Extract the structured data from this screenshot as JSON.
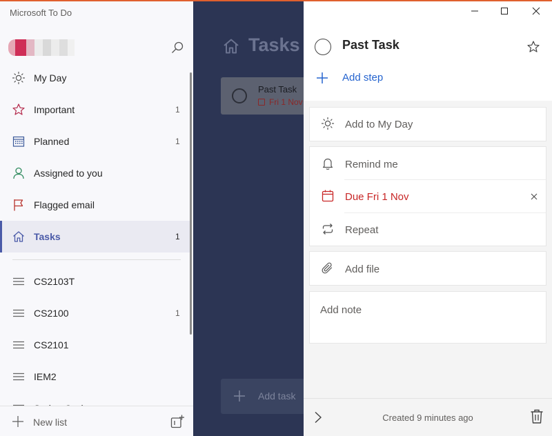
{
  "app": {
    "title": "Microsoft To Do"
  },
  "colors": {
    "accent": "#4a5aa8",
    "link": "#2564cf",
    "due_red": "#c82626",
    "overlay": "#2c3554",
    "top_border": "#e0602e"
  },
  "sidebar": {
    "profile_avatar": "blurred-avatar",
    "nav": [
      {
        "icon": "sun-icon",
        "label": "My Day",
        "count": ""
      },
      {
        "icon": "star-icon",
        "label": "Important",
        "count": "1"
      },
      {
        "icon": "calendar-grid-icon",
        "label": "Planned",
        "count": "1"
      },
      {
        "icon": "person-icon",
        "label": "Assigned to you",
        "count": ""
      },
      {
        "icon": "flag-icon",
        "label": "Flagged email",
        "count": ""
      },
      {
        "icon": "home-icon",
        "label": "Tasks",
        "count": "1",
        "active": true
      }
    ],
    "lists": [
      {
        "icon": "list-icon",
        "label": "CS2103T",
        "count": ""
      },
      {
        "icon": "list-icon",
        "label": "CS2100",
        "count": "1"
      },
      {
        "icon": "list-icon",
        "label": "CS2101",
        "count": ""
      },
      {
        "icon": "list-icon",
        "label": "IEM2",
        "count": ""
      },
      {
        "icon": "list-icon",
        "label": "Spring Cycle",
        "count": ""
      }
    ],
    "new_list_label": "New list"
  },
  "main": {
    "title": "Tasks",
    "tasks": [
      {
        "name": "Past Task",
        "due": "Fri 1 Nov"
      }
    ],
    "add_task_label": "Add task"
  },
  "detail": {
    "task_title": "Past Task",
    "add_step_label": "Add step",
    "add_to_my_day_label": "Add to My Day",
    "remind_label": "Remind me",
    "due_label": "Due Fri 1 Nov",
    "repeat_label": "Repeat",
    "add_file_label": "Add file",
    "note_placeholder": "Add note",
    "created_text": "Created 9 minutes ago"
  }
}
